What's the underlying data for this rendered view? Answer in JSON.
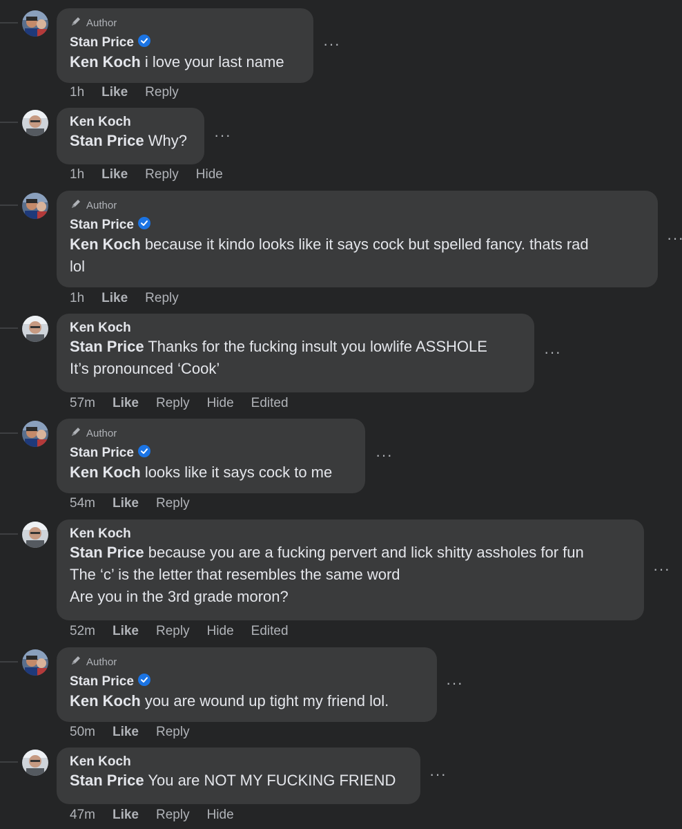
{
  "labels": {
    "author": "Author",
    "like": "Like",
    "reply": "Reply",
    "hide": "Hide",
    "edited": "Edited",
    "more": "···"
  },
  "comments": [
    {
      "name": "Stan Price",
      "author": true,
      "mention": "Ken Koch",
      "lines": [
        "i love your last name"
      ],
      "time": "1h",
      "hide": false,
      "edited": false
    },
    {
      "name": "Ken Koch",
      "author": false,
      "mention": "Stan Price",
      "lines": [
        "Why?"
      ],
      "time": "1h",
      "hide": true,
      "edited": false
    },
    {
      "name": "Stan Price",
      "author": true,
      "mention": "Ken Koch",
      "lines": [
        "because it kindo looks like it says cock but spelled fancy. thats rad",
        "lol"
      ],
      "time": "1h",
      "hide": false,
      "edited": false
    },
    {
      "name": "Ken Koch",
      "author": false,
      "mention": "Stan Price",
      "lines": [
        "Thanks for the fucking insult you lowlife ASSHOLE",
        "It’s pronounced ‘Cook’"
      ],
      "time": "57m",
      "hide": true,
      "edited": true
    },
    {
      "name": "Stan Price",
      "author": true,
      "mention": "Ken Koch",
      "lines": [
        "looks like it says cock to me"
      ],
      "time": "54m",
      "hide": false,
      "edited": false
    },
    {
      "name": "Ken Koch",
      "author": false,
      "mention": "Stan Price",
      "lines": [
        "because you are a fucking pervert and lick shitty assholes for fun",
        "The ‘c’ is the letter that resembles the same word",
        "Are you in the 3rd grade moron?"
      ],
      "time": "52m",
      "hide": true,
      "edited": true
    },
    {
      "name": "Stan Price",
      "author": true,
      "mention": "Ken Koch",
      "lines": [
        "you are wound up tight my friend lol."
      ],
      "time": "50m",
      "hide": false,
      "edited": false
    },
    {
      "name": "Ken Koch",
      "author": false,
      "mention": "Stan Price",
      "lines": [
        "You are NOT MY FUCKING FRIEND"
      ],
      "time": "47m",
      "hide": true,
      "edited": false
    }
  ],
  "colors": {
    "background": "#242526",
    "bubble": "#3a3b3c",
    "text": "#e4e6eb",
    "secondary": "#b0b3b8",
    "verified": "#1b74e4"
  }
}
